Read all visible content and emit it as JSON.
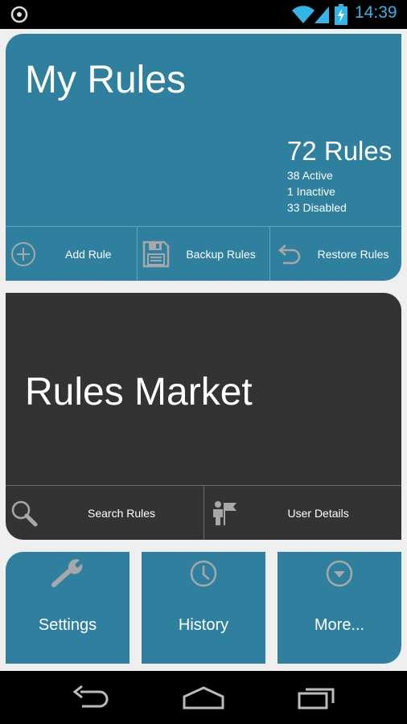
{
  "status_bar": {
    "time": "14:39"
  },
  "my_rules": {
    "title": "My Rules",
    "count": "72 Rules",
    "active": "38 Active",
    "inactive": "1 Inactive",
    "disabled": "33 Disabled",
    "actions": [
      "Add Rule",
      "Backup Rules",
      "Restore Rules"
    ]
  },
  "market": {
    "title": "Rules Market",
    "actions": [
      "Search Rules",
      "User Details"
    ]
  },
  "tiles": [
    "Settings",
    "History",
    "More..."
  ],
  "colors": {
    "card_blue": "#2f7f9f",
    "card_dark": "#333333",
    "clock_blue": "#33b5e5",
    "icon_gray": "#a8a8a8"
  },
  "icons": {
    "status": [
      "notification-icon",
      "wifi-icon",
      "signal-icon",
      "battery-charging-icon"
    ],
    "my_actions": [
      "add-circle-icon",
      "floppy-disk-icon",
      "undo-arrow-icon"
    ],
    "market_actions": [
      "magnifier-icon",
      "user-flag-icon"
    ],
    "tiles": [
      "wrench-icon",
      "clock-icon",
      "chevron-down-circle-icon"
    ],
    "nav": [
      "back-icon",
      "home-icon",
      "recent-apps-icon"
    ]
  }
}
